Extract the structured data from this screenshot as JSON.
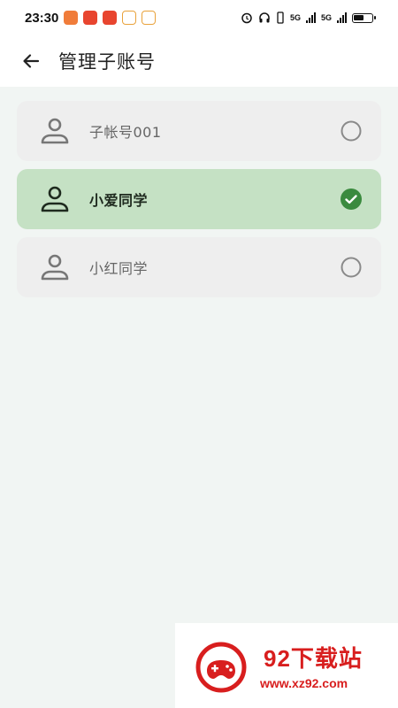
{
  "status_bar": {
    "time": "23:30",
    "net1": "5G",
    "net2": "5G",
    "battery_level": 0.6
  },
  "header": {
    "back_icon": "arrow-left-icon",
    "title": "管理子账号"
  },
  "accounts": [
    {
      "name": "子帐号001",
      "selected": false
    },
    {
      "name": "小爱同学",
      "selected": true
    },
    {
      "name": "小红同学",
      "selected": false
    }
  ],
  "watermark": {
    "title": "92下载站",
    "url": "www.xz92.com"
  },
  "colors": {
    "selected_bg": "#c5e1c4",
    "item_bg": "#eeeeee",
    "check_green": "#3a8a3e",
    "brand_red": "#d81e1e"
  }
}
